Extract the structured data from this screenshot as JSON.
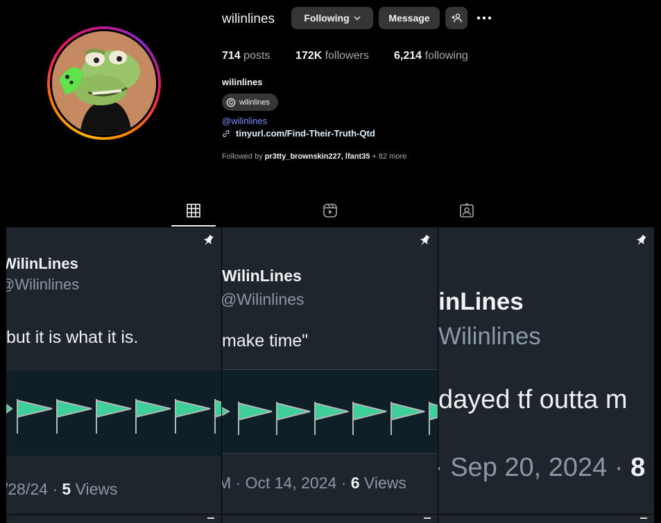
{
  "profile": {
    "username": "wilinlines",
    "buttons": {
      "following": "Following",
      "message": "Message"
    },
    "stats": {
      "posts": "714",
      "posts_label": "posts",
      "followers": "172K",
      "followers_label": "followers",
      "following": "6,214",
      "following_label": "following"
    },
    "full_name": "wilinlines",
    "threads_chip": "wilinlines",
    "mention": "@wilinlines",
    "link": "tinyurl.com/Find-Their-Truth-Qtd",
    "followed_by": {
      "prefix": "Followed by ",
      "users": "pr3tty_brownskin227, lfant35",
      "more": " + 82 more"
    }
  },
  "tabs": [
    {
      "icon": "grid-icon",
      "active": true
    },
    {
      "icon": "reels-icon",
      "active": false
    },
    {
      "icon": "tagged-icon",
      "active": false
    }
  ],
  "posts": [
    {
      "pinned": true,
      "name": "WilinLines",
      "handle": "@Wilinlines",
      "text": "but it is what it is.",
      "foot_prefix": "/28/24 · ",
      "views": "5",
      "views_label": " Views"
    },
    {
      "pinned": true,
      "name": "WilinLines",
      "handle": "@Wilinlines",
      "text": "make time\"",
      "foot_prefix": "M · Oct 14, 2024 · ",
      "views": "6",
      "views_label": " Views"
    },
    {
      "pinned": true,
      "name": "WilinLines",
      "handle": "Wilinlines",
      "text": "dayed tf outta m",
      "foot_prefix": "· Sep 20, 2024 · ",
      "views": "8",
      "views_label": ""
    }
  ],
  "colors": {
    "background": "#000000",
    "button": "#363636",
    "link": "#7d8cff",
    "tile": "#1f252d",
    "flag": "#3ecf9a"
  }
}
